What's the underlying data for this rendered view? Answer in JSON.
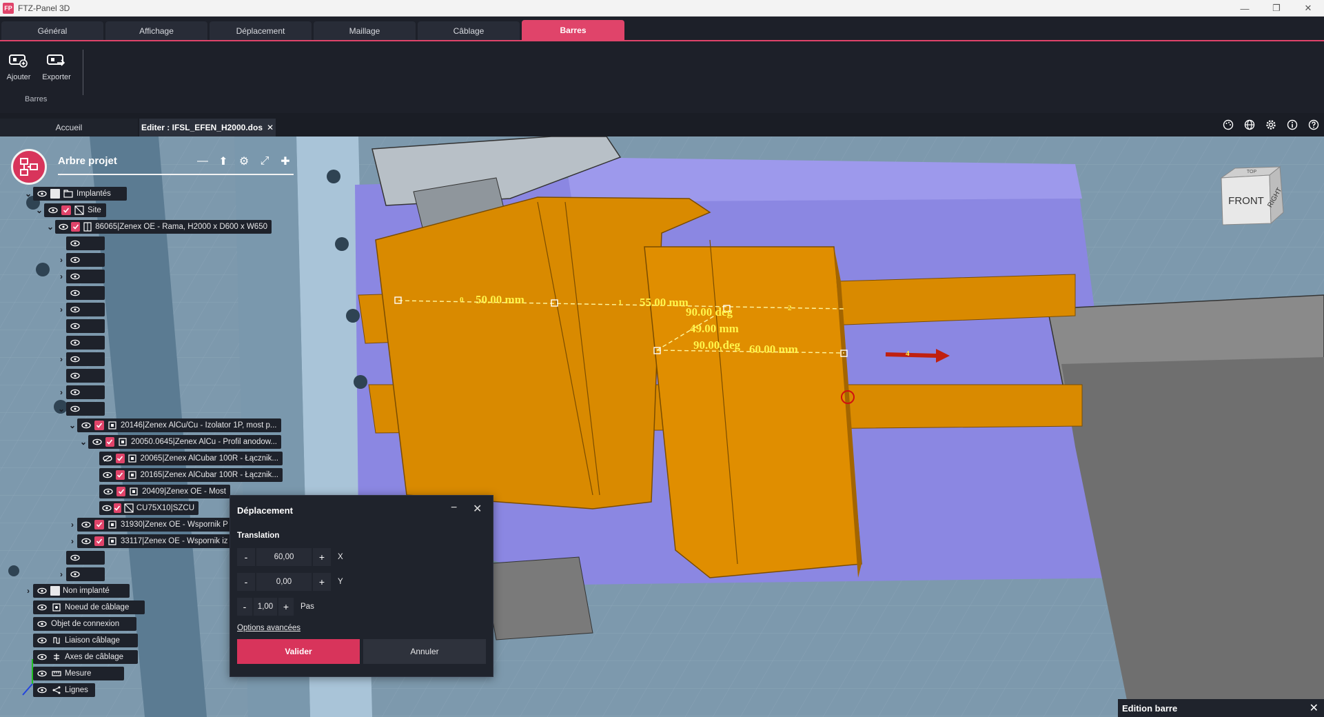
{
  "window": {
    "title": "FTZ-Panel 3D",
    "logo": "FP",
    "minimize": "—",
    "restore": "❐",
    "close": "✕"
  },
  "ribbon": {
    "tabs": [
      "Général",
      "Affichage",
      "Déplacement",
      "Maillage",
      "Câblage",
      "Barres"
    ],
    "active_tab": "Barres",
    "buttons": [
      {
        "label": "Ajouter",
        "icon": "add-bar-icon"
      },
      {
        "label": "Exporter",
        "icon": "export-bar-icon"
      }
    ],
    "group_label": "Barres"
  },
  "doc_tabs": {
    "home": "Accueil",
    "active": "Editer : IFSL_EFEN_H2000.dos",
    "close": "✕"
  },
  "viewport_icons": [
    "palette-icon",
    "globe-icon",
    "gear-icon",
    "info-icon",
    "help-icon"
  ],
  "navcube": {
    "front": "FRONT",
    "right": "RIGHT",
    "top": "TOP"
  },
  "project_tree": {
    "title": "Arbre projet",
    "tools": [
      "—",
      "⬆",
      "⚙",
      "⤢",
      "✚"
    ],
    "nodes": {
      "implantes": "Implantés",
      "site": "Site",
      "rama": "86065|Zenex  OE - Rama, H2000 x D600 x W650",
      "izolator": "20146|Zenex  AlCu/Cu - Izolator 1P, most p...",
      "profil": "20050.0645|Zenex  AlCu - Profil anodow...",
      "alcubar1": "20065|Zenex  AlCubar 100R - Łącznik...",
      "alcubar2": "20165|Zenex  AlCubar 100R - Łącznik...",
      "most": "20409|Zenex  OE - Most",
      "cu": "CU75X10|SZCU",
      "wspornik1": "31930|Zenex  OE - Wspornik P",
      "wspornik2": "33117|Zenex  OE - Wspornik iz",
      "non_implante": "Non implanté",
      "noeud": "Noeud de câblage",
      "objet": "Objet de connexion",
      "liaison": "Liaison câblage",
      "axes": "Axes de câblage",
      "mesure": "Mesure",
      "lignes": "Lignes"
    }
  },
  "measurements": {
    "labels": [
      "50.00 mm",
      "55.00 mm",
      "90.00 deg",
      "49.00 mm",
      "90.00 deg",
      "60.00 mm"
    ],
    "indices": [
      "0",
      "1",
      "2",
      "3",
      "4"
    ]
  },
  "dialog": {
    "title": "Déplacement",
    "minimize": "−",
    "close": "✕",
    "section": "Translation",
    "x": {
      "value": "60,00",
      "axis": "X"
    },
    "y": {
      "value": "0,00",
      "axis": "Y"
    },
    "step": {
      "value": "1,00",
      "label": "Pas"
    },
    "minus": "-",
    "plus": "+",
    "advanced": "Options avancées",
    "ok": "Valider",
    "cancel": "Annuler"
  },
  "edition_panel": {
    "title": "Edition barre",
    "close": "✕"
  },
  "colors": {
    "accent": "#e0446a",
    "bar": "#d98a00",
    "plate": "#8884e0",
    "cabinet": "#7f9fb6"
  }
}
